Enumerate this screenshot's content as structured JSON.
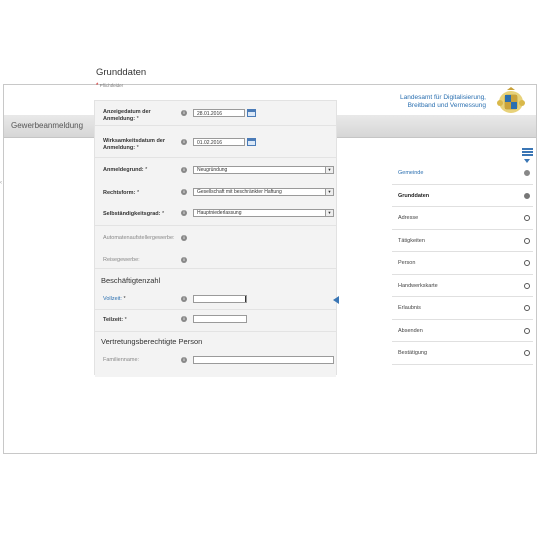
{
  "header": {
    "org_line1": "Landesamt für Digitalisierung,",
    "org_line2": "Breitband und Vermessung",
    "title": "Gewerbeanmeldung"
  },
  "form": {
    "heading": "Grunddaten",
    "required_hint": "Pflichtfelder",
    "required_mark": "*",
    "fields": {
      "anzeige_label1": "Anzeigedatum der",
      "anzeige_label2": "Anmeldung:",
      "anzeige_value": "28.01.2016",
      "wirksam_label1": "Wirksamkeitsdatum der",
      "wirksam_label2": "Anmeldung:",
      "wirksam_value": "01.02.2016",
      "grund_label": "Anmeldegrund:",
      "grund_value": "Neugründung",
      "rechtsform_label": "Rechtsform:",
      "rechtsform_value": "Gesellschaft mit beschränkter Haftung",
      "grad_label": "Selbständigkeitsgrad:",
      "grad_value": "Hauptniederlassung",
      "automaten_label": "Automatenaufstellergewerbe:",
      "reise_label": "Reisegewerbe:"
    },
    "beschaeftigte": {
      "heading": "Beschäftigtenzahl",
      "vollzeit_label": "Vollzeit:",
      "teilzeit_label": "Teilzeit:",
      "vollzeit_value": "",
      "teilzeit_value": ""
    },
    "vertretung": {
      "heading": "Vertretungsberechtigte Person",
      "familienname_label": "Familienname:",
      "familienname_value": ""
    }
  },
  "steps": [
    {
      "label": "Gemeinde",
      "state": "done"
    },
    {
      "label": "Grunddaten",
      "state": "active"
    },
    {
      "label": "Adresse",
      "state": "open"
    },
    {
      "label": "Tätigkeiten",
      "state": "open"
    },
    {
      "label": "Person",
      "state": "open"
    },
    {
      "label": "Handwerkskarte",
      "state": "open"
    },
    {
      "label": "Erlaubnis",
      "state": "open"
    },
    {
      "label": "Absenden",
      "state": "open"
    },
    {
      "label": "Bestätigung",
      "state": "open"
    }
  ],
  "icons": {
    "info": "info-icon",
    "calendar": "calendar-icon",
    "list": "list-icon",
    "crest": "bavarian-crest-logo"
  },
  "colors": {
    "accent": "#3a76b5",
    "titlebar": "#dcdcdc",
    "form_bg": "#f3f3f3"
  }
}
